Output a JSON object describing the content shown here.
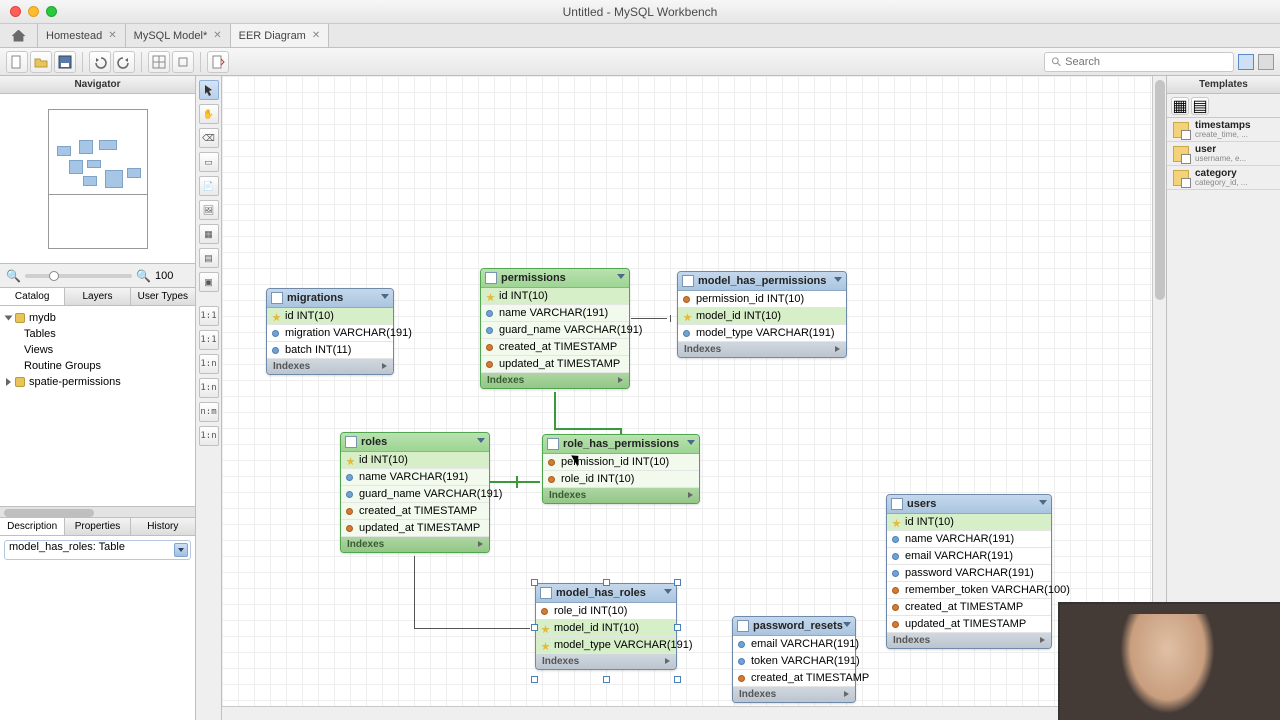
{
  "window": {
    "title": "Untitled - MySQL Workbench"
  },
  "tabs": [
    {
      "label": "Homestead",
      "active": false
    },
    {
      "label": "MySQL Model*",
      "active": false
    },
    {
      "label": "EER Diagram",
      "active": true
    }
  ],
  "search": {
    "placeholder": "Search"
  },
  "navigator": {
    "header": "Navigator",
    "zoom": "100",
    "cat_tabs": [
      "Catalog",
      "Layers",
      "User Types"
    ],
    "tree": {
      "db1": "mydb",
      "tables": "Tables",
      "views": "Views",
      "routine_groups": "Routine Groups",
      "db2": "spatie-permissions"
    },
    "desc_tabs": [
      "Description",
      "Properties",
      "History"
    ],
    "desc_value": "model_has_roles: Table"
  },
  "palette_rel": [
    "1:1",
    "1:1",
    "1:n",
    "1:n",
    "n:m",
    "1:n"
  ],
  "templates": {
    "header": "Templates",
    "items": [
      {
        "name": "timestamps",
        "sub": "create_time, ..."
      },
      {
        "name": "user",
        "sub": "username, e..."
      },
      {
        "name": "category",
        "sub": "category_id, ..."
      }
    ]
  },
  "entities": {
    "migrations": {
      "title": "migrations",
      "idx": "Indexes",
      "cols": [
        "id INT(10)",
        "migration VARCHAR(191)",
        "batch INT(11)"
      ]
    },
    "permissions": {
      "title": "permissions",
      "idx": "Indexes",
      "cols": [
        "id INT(10)",
        "name VARCHAR(191)",
        "guard_name VARCHAR(191)",
        "created_at TIMESTAMP",
        "updated_at TIMESTAMP"
      ]
    },
    "model_has_permissions": {
      "title": "model_has_permissions",
      "idx": "Indexes",
      "cols": [
        "permission_id INT(10)",
        "model_id INT(10)",
        "model_type VARCHAR(191)"
      ]
    },
    "roles": {
      "title": "roles",
      "idx": "Indexes",
      "cols": [
        "id INT(10)",
        "name VARCHAR(191)",
        "guard_name VARCHAR(191)",
        "created_at TIMESTAMP",
        "updated_at TIMESTAMP"
      ]
    },
    "role_has_permissions": {
      "title": "role_has_permissions",
      "idx": "Indexes",
      "cols": [
        "permission_id INT(10)",
        "role_id INT(10)"
      ]
    },
    "model_has_roles": {
      "title": "model_has_roles",
      "idx": "Indexes",
      "cols": [
        "role_id INT(10)",
        "model_id INT(10)",
        "model_type VARCHAR(191)"
      ]
    },
    "password_resets": {
      "title": "password_resets",
      "idx": "Indexes",
      "cols": [
        "email VARCHAR(191)",
        "token VARCHAR(191)",
        "created_at TIMESTAMP"
      ]
    },
    "users": {
      "title": "users",
      "idx": "Indexes",
      "cols": [
        "id INT(10)",
        "name VARCHAR(191)",
        "email VARCHAR(191)",
        "password VARCHAR(191)",
        "remember_token VARCHAR(100)",
        "created_at TIMESTAMP",
        "updated_at TIMESTAMP"
      ]
    }
  }
}
